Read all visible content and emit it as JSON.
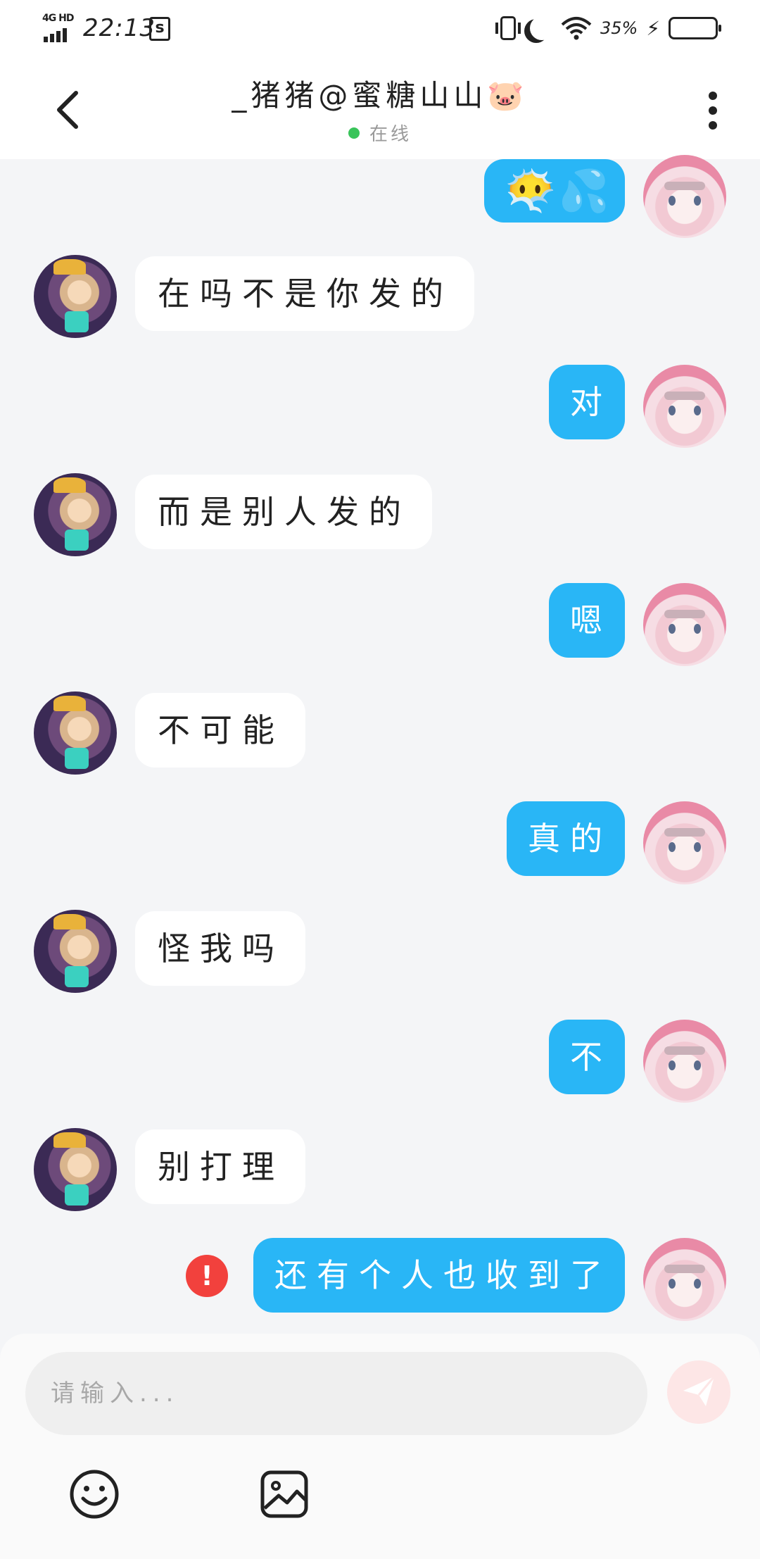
{
  "status_bar": {
    "network": "4G HD",
    "time": "22:13",
    "battery_percent": "35%",
    "battery_level": 0.35,
    "icons": [
      "screenshot-icon",
      "vibrate-icon",
      "do-not-disturb-moon-icon",
      "wifi-icon",
      "charging-bolt-icon",
      "battery-icon"
    ]
  },
  "header": {
    "title": "_猪猪@蜜糖山山🐷",
    "status": "在线",
    "status_color": "#39c45a"
  },
  "colors": {
    "accent": "#29b6f6",
    "background": "#f4f5f7",
    "error": "#f2413d"
  },
  "messages": [
    {
      "from": "me",
      "text": "😶‍🌫️💦"
    },
    {
      "from": "peer",
      "text": "在吗不是你发的"
    },
    {
      "from": "me",
      "text": "对"
    },
    {
      "from": "peer",
      "text": "而是别人发的"
    },
    {
      "from": "me",
      "text": "嗯"
    },
    {
      "from": "peer",
      "text": "不可能"
    },
    {
      "from": "me",
      "text": "真的"
    },
    {
      "from": "peer",
      "text": "怪我吗"
    },
    {
      "from": "me",
      "text": "不"
    },
    {
      "from": "peer",
      "text": "别打理"
    },
    {
      "from": "me",
      "text": "还有个人也收到了",
      "send_failed": true,
      "error_mark": "!"
    }
  ],
  "input": {
    "placeholder": "请输入...",
    "value": ""
  },
  "toolbar": {
    "icons": [
      "emoji-icon",
      "image-icon",
      "send-icon"
    ]
  }
}
